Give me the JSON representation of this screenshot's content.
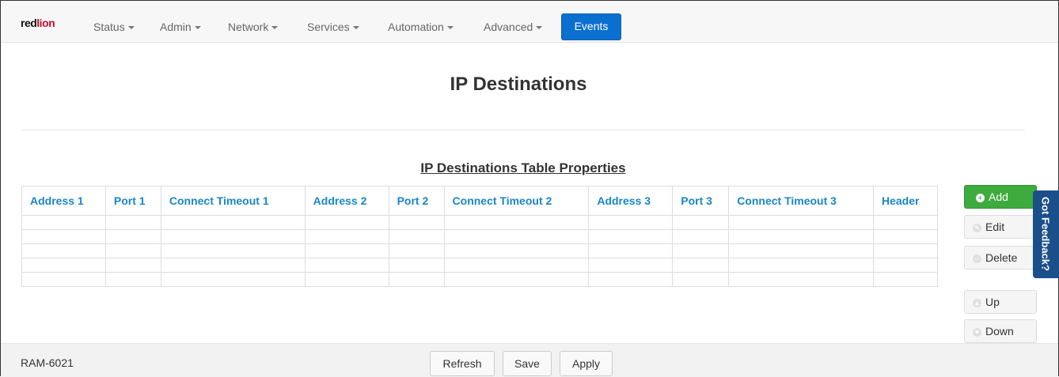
{
  "navbar": {
    "logo_red": "red",
    "logo_lion": "lion",
    "items": [
      {
        "label": "Status"
      },
      {
        "label": "Admin"
      },
      {
        "label": "Network"
      },
      {
        "label": "Services"
      },
      {
        "label": "Automation"
      },
      {
        "label": "Advanced"
      }
    ],
    "active": {
      "label": "Events"
    }
  },
  "page": {
    "title": "IP Destinations",
    "table_title": "IP Destinations Table Properties"
  },
  "table": {
    "columns": [
      "Address 1",
      "Port 1",
      "Connect Timeout 1",
      "Address 2",
      "Port 2",
      "Connect Timeout 2",
      "Address 3",
      "Port 3",
      "Connect Timeout 3",
      "Header"
    ],
    "empty_rows": 5
  },
  "side_buttons": {
    "add": "Add",
    "edit": "Edit",
    "delete": "Delete",
    "up": "Up",
    "down": "Down"
  },
  "feedback": {
    "label": "Got Feedback?"
  },
  "footer": {
    "device": "RAM-6021",
    "refresh": "Refresh",
    "save": "Save",
    "apply": "Apply"
  },
  "colors": {
    "accent": "#0b6fd0",
    "header_text": "#1a86c8",
    "add_green": "#3eab3e",
    "feedback_bg": "#1b4f8a"
  }
}
